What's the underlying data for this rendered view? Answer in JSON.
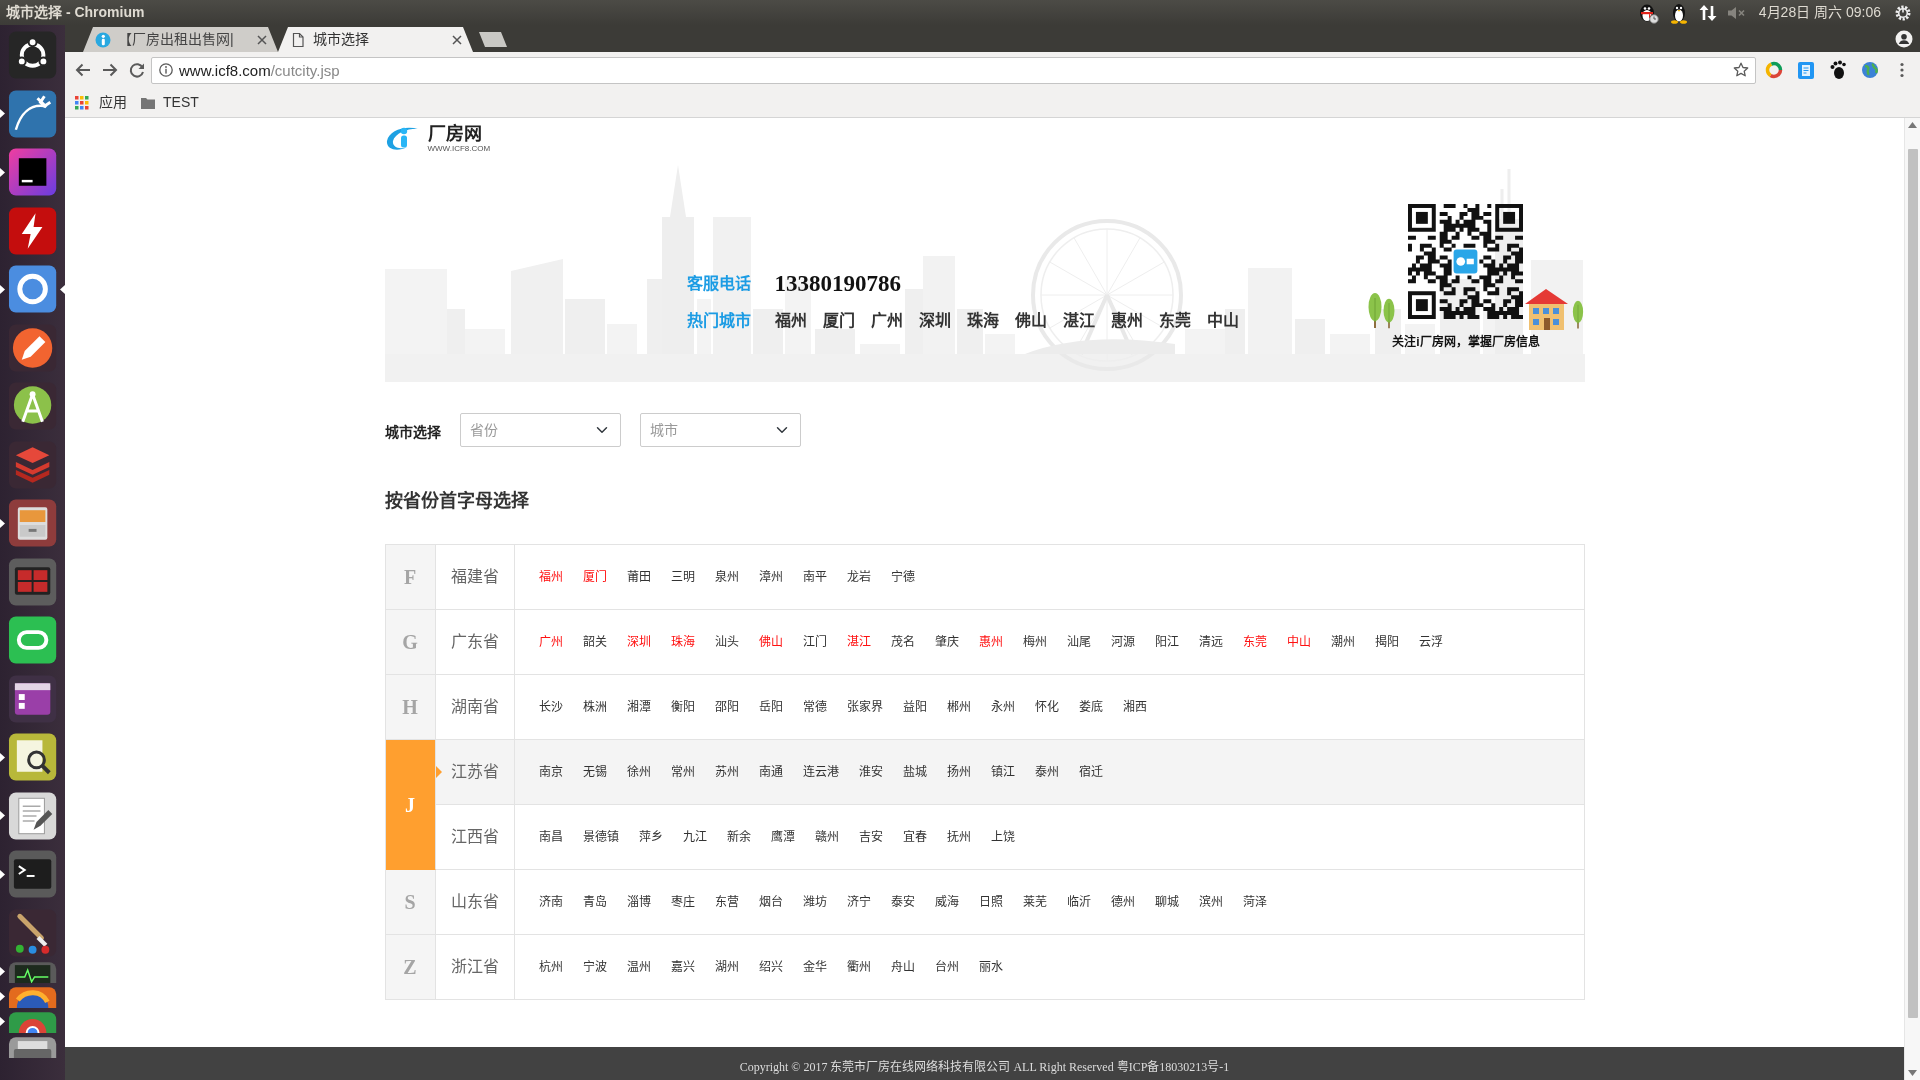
{
  "top_bar": {
    "title": "城市选择 - Chromium",
    "volume_muted": true,
    "clock": "4月28日 周六 09:06"
  },
  "launcher": [
    {
      "running": false,
      "focused": false
    },
    {
      "running": true,
      "focused": false
    },
    {
      "running": true,
      "focused": false
    },
    {
      "running": false,
      "focused": false
    },
    {
      "running": true,
      "focused": true
    },
    {
      "running": false,
      "focused": false
    },
    {
      "running": false,
      "focused": false
    },
    {
      "running": false,
      "focused": false
    },
    {
      "running": true,
      "focused": false
    },
    {
      "running": false,
      "focused": false
    },
    {
      "running": false,
      "focused": false
    },
    {
      "running": false,
      "focused": false
    },
    {
      "running": true,
      "focused": false
    },
    {
      "running": true,
      "focused": false
    },
    {
      "running": true,
      "focused": false
    },
    {
      "running": false,
      "focused": false
    },
    {
      "running": true,
      "focused": false
    },
    {
      "running": true,
      "focused": false
    },
    {
      "running": true,
      "focused": false
    },
    {
      "running": false,
      "focused": false
    }
  ],
  "tabs": [
    {
      "kind": "site",
      "title": "【厂房出租出售网|",
      "selected": false
    },
    {
      "kind": "page",
      "title": "城市选择",
      "selected": true
    }
  ],
  "address_bar": {
    "host": "www.icf8.com",
    "path": "/cutcity.jsp",
    "bookmarked": false
  },
  "bookmarks": [
    {
      "kind": "apps",
      "label": "应用"
    },
    {
      "kind": "folder",
      "label": "TEST"
    }
  ],
  "site": {
    "name": "厂房网",
    "domain": "WWW.ICF8.COM"
  },
  "banner": {
    "phone_label": "客服电话",
    "phone": "13380190786",
    "hot_label": "热门城市",
    "hot_cities": [
      "福州",
      "厦门",
      "广州",
      "深圳",
      "珠海",
      "佛山",
      "湛江",
      "惠州",
      "东莞",
      "中山"
    ],
    "qr_caption": "关注i厂房网，掌握厂房信息"
  },
  "city_picker": {
    "label": "城市选择",
    "province_select": {
      "placeholder": "省份"
    },
    "city_select": {
      "placeholder": "城市"
    }
  },
  "section_title": "按省份首字母选择",
  "groups": [
    {
      "letter": "F",
      "selected": false,
      "provinces": [
        {
          "name": "福建省",
          "selected": false,
          "cities": [
            {
              "name": "福州",
              "hot": true
            },
            {
              "name": "厦门",
              "hot": true
            },
            {
              "name": "莆田",
              "hot": false
            },
            {
              "name": "三明",
              "hot": false
            },
            {
              "name": "泉州",
              "hot": false
            },
            {
              "name": "漳州",
              "hot": false
            },
            {
              "name": "南平",
              "hot": false
            },
            {
              "name": "龙岩",
              "hot": false
            },
            {
              "name": "宁德",
              "hot": false
            }
          ]
        }
      ]
    },
    {
      "letter": "G",
      "selected": false,
      "provinces": [
        {
          "name": "广东省",
          "selected": false,
          "cities": [
            {
              "name": "广州",
              "hot": true
            },
            {
              "name": "韶关",
              "hot": false
            },
            {
              "name": "深圳",
              "hot": true
            },
            {
              "name": "珠海",
              "hot": true
            },
            {
              "name": "汕头",
              "hot": false
            },
            {
              "name": "佛山",
              "hot": true
            },
            {
              "name": "江门",
              "hot": false
            },
            {
              "name": "湛江",
              "hot": true
            },
            {
              "name": "茂名",
              "hot": false
            },
            {
              "name": "肇庆",
              "hot": false
            },
            {
              "name": "惠州",
              "hot": true
            },
            {
              "name": "梅州",
              "hot": false
            },
            {
              "name": "汕尾",
              "hot": false
            },
            {
              "name": "河源",
              "hot": false
            },
            {
              "name": "阳江",
              "hot": false
            },
            {
              "name": "清远",
              "hot": false
            },
            {
              "name": "东莞",
              "hot": true
            },
            {
              "name": "中山",
              "hot": true
            },
            {
              "name": "潮州",
              "hot": false
            },
            {
              "name": "揭阳",
              "hot": false
            },
            {
              "name": "云浮",
              "hot": false
            }
          ]
        }
      ]
    },
    {
      "letter": "H",
      "selected": false,
      "provinces": [
        {
          "name": "湖南省",
          "selected": false,
          "cities": [
            {
              "name": "长沙",
              "hot": false
            },
            {
              "name": "株洲",
              "hot": false
            },
            {
              "name": "湘潭",
              "hot": false
            },
            {
              "name": "衡阳",
              "hot": false
            },
            {
              "name": "邵阳",
              "hot": false
            },
            {
              "name": "岳阳",
              "hot": false
            },
            {
              "name": "常德",
              "hot": false
            },
            {
              "name": "张家界",
              "hot": false
            },
            {
              "name": "益阳",
              "hot": false
            },
            {
              "name": "郴州",
              "hot": false
            },
            {
              "name": "永州",
              "hot": false
            },
            {
              "name": "怀化",
              "hot": false
            },
            {
              "name": "娄底",
              "hot": false
            },
            {
              "name": "湘西",
              "hot": false
            }
          ]
        }
      ]
    },
    {
      "letter": "J",
      "selected": true,
      "provinces": [
        {
          "name": "江苏省",
          "selected": true,
          "cities": [
            {
              "name": "南京",
              "hot": false
            },
            {
              "name": "无锡",
              "hot": false
            },
            {
              "name": "徐州",
              "hot": false
            },
            {
              "name": "常州",
              "hot": false
            },
            {
              "name": "苏州",
              "hot": false
            },
            {
              "name": "南通",
              "hot": false
            },
            {
              "name": "连云港",
              "hot": false
            },
            {
              "name": "淮安",
              "hot": false
            },
            {
              "name": "盐城",
              "hot": false
            },
            {
              "name": "扬州",
              "hot": false
            },
            {
              "name": "镇江",
              "hot": false
            },
            {
              "name": "泰州",
              "hot": false
            },
            {
              "name": "宿迁",
              "hot": false
            }
          ]
        },
        {
          "name": "江西省",
          "selected": false,
          "cities": [
            {
              "name": "南昌",
              "hot": false
            },
            {
              "name": "景德镇",
              "hot": false
            },
            {
              "name": "萍乡",
              "hot": false
            },
            {
              "name": "九江",
              "hot": false
            },
            {
              "name": "新余",
              "hot": false
            },
            {
              "name": "鹰潭",
              "hot": false
            },
            {
              "name": "赣州",
              "hot": false
            },
            {
              "name": "吉安",
              "hot": false
            },
            {
              "name": "宜春",
              "hot": false
            },
            {
              "name": "抚州",
              "hot": false
            },
            {
              "name": "上饶",
              "hot": false
            }
          ]
        }
      ]
    },
    {
      "letter": "S",
      "selected": false,
      "provinces": [
        {
          "name": "山东省",
          "selected": false,
          "cities": [
            {
              "name": "济南",
              "hot": false
            },
            {
              "name": "青岛",
              "hot": false
            },
            {
              "name": "淄博",
              "hot": false
            },
            {
              "name": "枣庄",
              "hot": false
            },
            {
              "name": "东营",
              "hot": false
            },
            {
              "name": "烟台",
              "hot": false
            },
            {
              "name": "潍坊",
              "hot": false
            },
            {
              "name": "济宁",
              "hot": false
            },
            {
              "name": "泰安",
              "hot": false
            },
            {
              "name": "威海",
              "hot": false
            },
            {
              "name": "日照",
              "hot": false
            },
            {
              "name": "莱芜",
              "hot": false
            },
            {
              "name": "临沂",
              "hot": false
            },
            {
              "name": "德州",
              "hot": false
            },
            {
              "name": "聊城",
              "hot": false
            },
            {
              "name": "滨州",
              "hot": false
            },
            {
              "name": "菏泽",
              "hot": false
            }
          ]
        }
      ]
    },
    {
      "letter": "Z",
      "selected": false,
      "provinces": [
        {
          "name": "浙江省",
          "selected": false,
          "cities": [
            {
              "name": "杭州",
              "hot": false
            },
            {
              "name": "宁波",
              "hot": false
            },
            {
              "name": "温州",
              "hot": false
            },
            {
              "name": "嘉兴",
              "hot": false
            },
            {
              "name": "湖州",
              "hot": false
            },
            {
              "name": "绍兴",
              "hot": false
            },
            {
              "name": "金华",
              "hot": false
            },
            {
              "name": "衢州",
              "hot": false
            },
            {
              "name": "舟山",
              "hot": false
            },
            {
              "name": "台州",
              "hot": false
            },
            {
              "name": "丽水",
              "hot": false
            }
          ]
        }
      ]
    }
  ],
  "footer": {
    "copyright": "Copyright © 2017 东莞市厂房在线网络科技有限公司 ALL Right Reserved 粤ICP备18030213号-1"
  }
}
